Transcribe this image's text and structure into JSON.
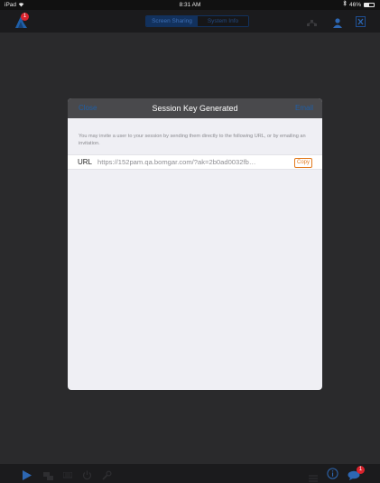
{
  "status_bar": {
    "device": "iPad",
    "time": "8:31 AM",
    "battery_text": "46%",
    "battery_level": 0.46
  },
  "toolbar": {
    "notification_badge": "1",
    "tabs": [
      {
        "label": "Screen Sharing",
        "active": true
      },
      {
        "label": "System Info",
        "active": false
      }
    ],
    "icons": [
      "notification-icon",
      "network-icon",
      "user-icon",
      "close-x-icon"
    ]
  },
  "modal": {
    "close_label": "Close",
    "title": "Session Key Generated",
    "email_label": "Email",
    "description": "You may invite a user to your session by sending them directly to the following URL, or by emailing an invitation.",
    "url_label": "URL",
    "url_value": "https://152pam.qa.bomgar.com/?ak=2b0ad0032fb…",
    "copy_label": "Copy"
  },
  "bottom_bar": {
    "chat_badge": "1",
    "icons": [
      "play-icon",
      "screens-icon",
      "keyboard-icon",
      "power-icon",
      "wrench-icon",
      "menu-icon",
      "info-icon",
      "chat-icon"
    ]
  },
  "colors": {
    "accent_blue": "#1f5fa8",
    "copy_orange": "#e27a1d",
    "badge_red": "#d9232d",
    "toolbar_bg": "#1b1b1d"
  }
}
